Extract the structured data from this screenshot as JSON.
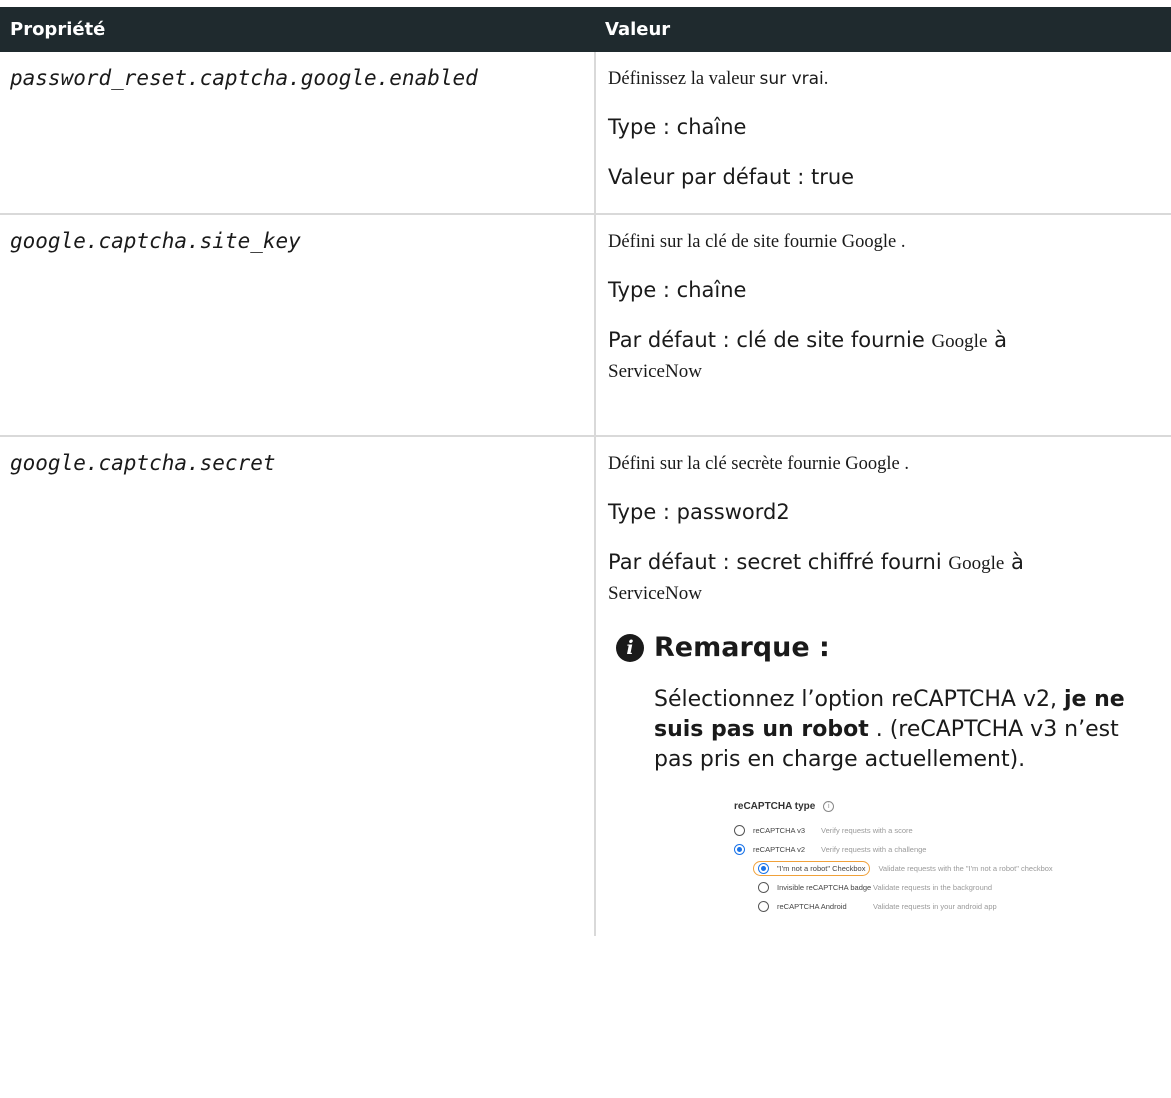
{
  "table": {
    "headers": {
      "property": "Propriété",
      "value": "Valeur"
    },
    "rows": [
      {
        "property": "password_reset.captcha.google.enabled",
        "line1": "Définissez la valeur ",
        "line1_code": "sur vrai",
        "line1_end": ".",
        "type": "Type : chaîne",
        "default": "Valeur par défaut : true"
      },
      {
        "property": "google.captcha.site_key",
        "line1": "Défini sur la clé de site fournie Google .",
        "type": "Type : chaîne",
        "default_a": "Par défaut : clé de site fournie ",
        "default_b": "Google",
        "default_c": " à ",
        "default_d": "ServiceNow"
      },
      {
        "property": "google.captcha.secret",
        "line1": "Défini sur la clé secrète fournie Google .",
        "type": "Type : password2",
        "default_a": "Par défaut : secret chiffré fourni ",
        "default_b": "Google",
        "default_c": " à ",
        "default_d": "ServiceNow",
        "note": {
          "icon": "info-icon",
          "title": "Remarque :",
          "text_a": "Sélectionnez l’option reCAPTCHA v2, ",
          "text_bold": "je ne suis pas un robot",
          "text_b": " . (reCAPTCHA v3 n’est pas pris en charge actuellement)."
        },
        "screenshot": {
          "header": "reCAPTCHA type",
          "options": [
            {
              "label": "reCAPTCHA v3",
              "desc": "Verify requests with a score",
              "selected": false
            },
            {
              "label": "reCAPTCHA v2",
              "desc": "Verify requests with a challenge",
              "selected": true
            }
          ],
          "sub_options": [
            {
              "label": "\"I'm not a robot\" Checkbox",
              "desc": "Validate requests with the \"I'm not a robot\" checkbox",
              "selected": true
            },
            {
              "label": "Invisible reCAPTCHA badge",
              "desc": "Validate requests in the background",
              "selected": false
            },
            {
              "label": "reCAPTCHA Android",
              "desc": "Validate requests in your android app",
              "selected": false
            }
          ]
        }
      }
    ]
  }
}
